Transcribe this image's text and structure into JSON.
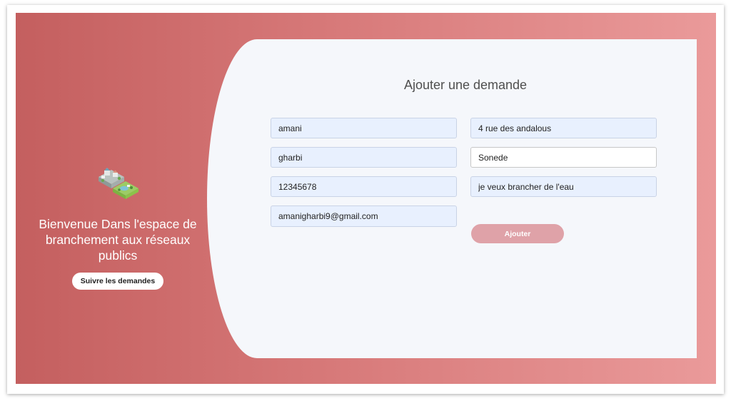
{
  "sidebar": {
    "illustration_icon": "city-network-illustration-icon",
    "welcome_text": "Bienvenue Dans l'espace de branchement aux réseaux publics",
    "track_button_label": "Suivre les demandes"
  },
  "form": {
    "title": "Ajouter une demande",
    "fields": {
      "first_name": "amani",
      "last_name": "gharbi",
      "phone": "12345678",
      "email": "amanigharbi9@gmail.com",
      "address": "4 rue des andalous",
      "provider": "Sonede",
      "description": "je veux brancher de l'eau"
    },
    "submit_label": "Ajouter"
  },
  "colors": {
    "banner_start": "#c45f5f",
    "banner_end": "#ea9a9a",
    "panel_bg": "#f5f7fb",
    "field_autofill_bg": "#e8f0fe",
    "submit_bg": "#dfa2a8"
  }
}
